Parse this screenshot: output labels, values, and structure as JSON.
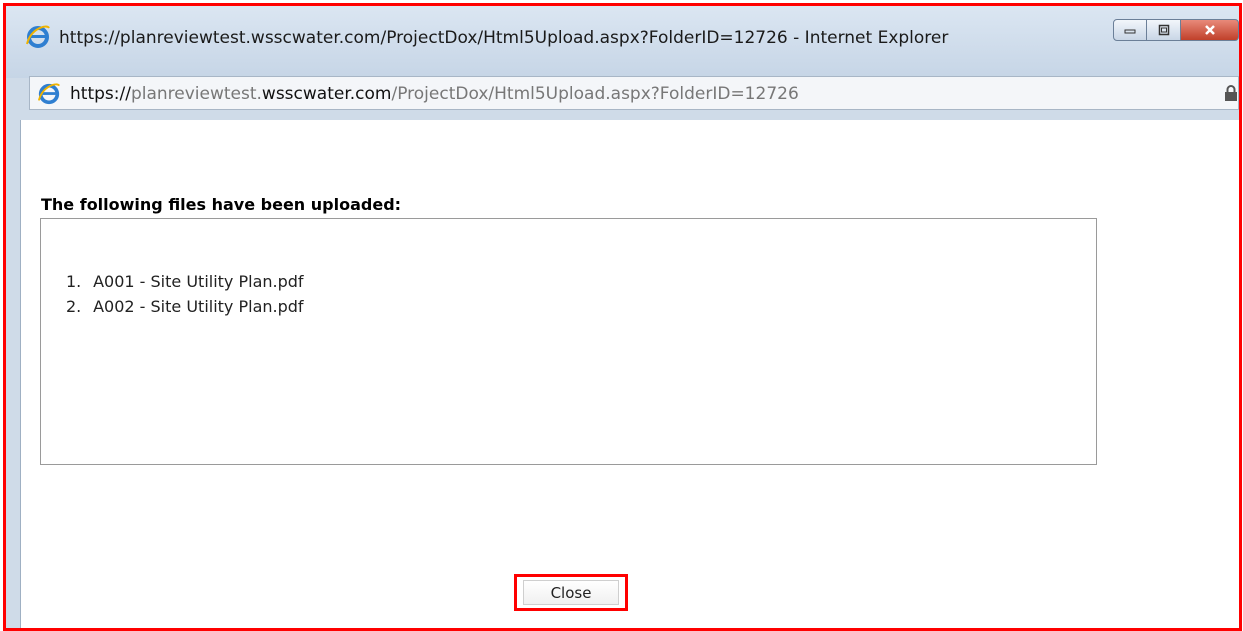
{
  "window": {
    "title": "https://planreviewtest.wsscwater.com/ProjectDox/Html5Upload.aspx?FolderID=12726 - Internet Explorer",
    "minimize_icon": "minimize-icon",
    "maximize_icon": "maximize-icon",
    "close_icon": "close-icon"
  },
  "address_bar": {
    "scheme": "https://",
    "host_light": "planreviewtest.",
    "host_dark": "wsscwater.com",
    "path": "/ProjectDox/Html5Upload.aspx?FolderID=12726",
    "icon": "ie-icon",
    "lock_icon": "lock-icon"
  },
  "dialog": {
    "heading": "The following files have been uploaded:",
    "files": [
      {
        "num": "1.",
        "name": "A001 - Site Utility Plan.pdf"
      },
      {
        "num": "2.",
        "name": "A002 - Site Utility Plan.pdf"
      }
    ],
    "close_label": "Close"
  },
  "colors": {
    "highlight": "#ff0000",
    "titlebar": "#c6d5e6"
  }
}
